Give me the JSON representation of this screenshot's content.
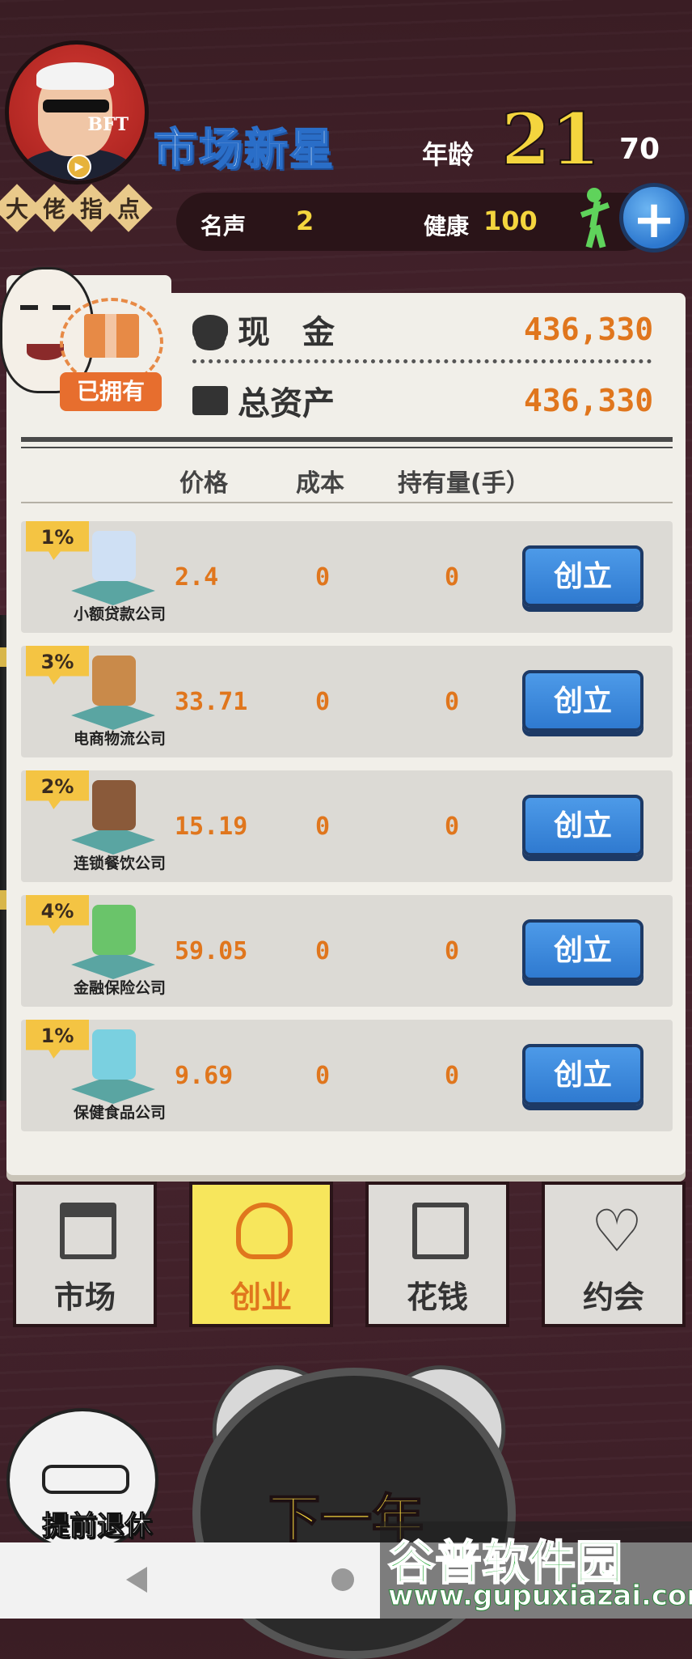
{
  "header": {
    "mentor_chars": [
      "大",
      "佬",
      "指",
      "点"
    ],
    "avatar_text": "BFT",
    "title": "市场新星",
    "age_label": "年龄",
    "age_value": "21",
    "age_max": "70",
    "fame_label": "名声",
    "fame_value": "2",
    "health_label": "健康",
    "health_value": "100",
    "add_icon": "plus-icon"
  },
  "assets": {
    "owned_label": "已拥有",
    "cash_label": "现　金",
    "cash_value": "436,330",
    "total_label": "总资产",
    "total_value": "436,330"
  },
  "table": {
    "headers": [
      "价格",
      "成本",
      "持有量(手）"
    ],
    "rows": [
      {
        "badge": "1%",
        "name": "小额贷款公司",
        "price": "2.4",
        "cost": "0",
        "holding": "0",
        "button": "创立",
        "icon": "pawn-shop-icon",
        "color": "#cfe0f4"
      },
      {
        "badge": "3%",
        "name": "电商物流公司",
        "price": "33.71",
        "cost": "0",
        "holding": "0",
        "button": "创立",
        "icon": "package-icon",
        "color": "#c98a4a"
      },
      {
        "badge": "2%",
        "name": "连锁餐饮公司",
        "price": "15.19",
        "cost": "0",
        "holding": "0",
        "button": "创立",
        "icon": "coffee-cup-icon",
        "color": "#8a5a3a"
      },
      {
        "badge": "4%",
        "name": "金融保险公司",
        "price": "59.05",
        "cost": "0",
        "holding": "0",
        "button": "创立",
        "icon": "insurance-family-icon",
        "color": "#6ac46a"
      },
      {
        "badge": "1%",
        "name": "保健食品公司",
        "price": "9.69",
        "cost": "0",
        "holding": "0",
        "button": "创立",
        "icon": "supplement-bottle-icon",
        "color": "#7ad0e0"
      }
    ]
  },
  "tabs": [
    {
      "label": "市场",
      "icon": "shop-icon",
      "active": false
    },
    {
      "label": "创业",
      "icon": "lightbulb-icon",
      "active": true
    },
    {
      "label": "花钱",
      "icon": "shopping-bag-icon",
      "active": false
    },
    {
      "label": "约会",
      "icon": "heart-icon",
      "active": false
    }
  ],
  "bottom": {
    "retire_label": "提前退休",
    "next_year_label": "下一年"
  },
  "watermark": {
    "title": "谷普软件园",
    "url": "www.gupuxiazai.com"
  },
  "colors": {
    "accent_orange": "#e0761d",
    "button_blue": "#2f7ad0",
    "active_tab": "#f7e65c",
    "badge_yellow": "#f4c443"
  }
}
